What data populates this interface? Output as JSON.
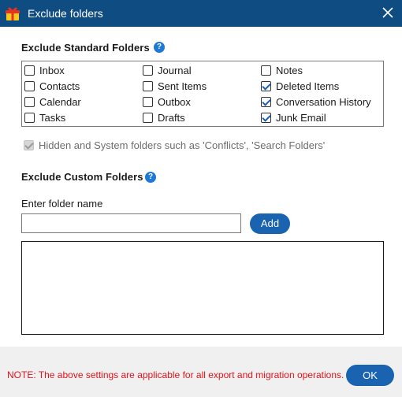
{
  "window": {
    "title": "Exclude folders",
    "close_icon": "close-icon",
    "app_icon": "gift-box-icon",
    "titlebar_color": "#0f4c81"
  },
  "standard": {
    "heading": "Exclude Standard Folders",
    "help_icon": "help-icon",
    "folders": [
      {
        "label": "Inbox",
        "checked": false
      },
      {
        "label": "Journal",
        "checked": false
      },
      {
        "label": "Notes",
        "checked": false
      },
      {
        "label": "Contacts",
        "checked": false
      },
      {
        "label": "Sent Items",
        "checked": false
      },
      {
        "label": "Deleted Items",
        "checked": true
      },
      {
        "label": "Calendar",
        "checked": false
      },
      {
        "label": "Outbox",
        "checked": false
      },
      {
        "label": "Conversation History",
        "checked": true
      },
      {
        "label": "Tasks",
        "checked": false
      },
      {
        "label": "Drafts",
        "checked": false
      },
      {
        "label": "Junk Email",
        "checked": true
      }
    ],
    "hidden_system": {
      "label": "Hidden and System folders such as 'Conflicts', 'Search Folders'",
      "checked": true,
      "disabled": true
    }
  },
  "custom": {
    "heading": "Exclude Custom Folders",
    "help_icon": "help-icon",
    "field_label": "Enter folder name",
    "input_value": "",
    "add_label": "Add"
  },
  "footer": {
    "note": "NOTE: The above settings are applicable for all export and migration operations.",
    "note_color": "#e0141e",
    "ok_label": "OK",
    "button_color": "#1a63b0"
  }
}
